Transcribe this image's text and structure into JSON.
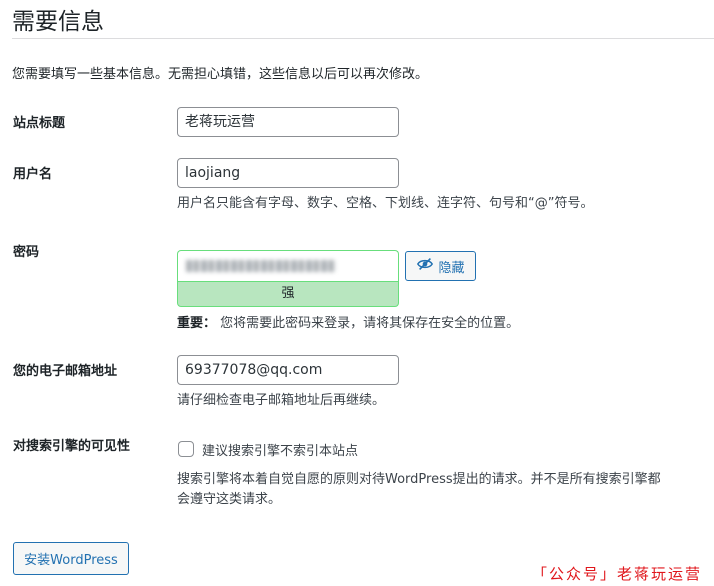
{
  "page": {
    "title": "需要信息",
    "intro": "您需要填写一些基本信息。无需担心填错，这些信息以后可以再次修改。"
  },
  "site_title": {
    "label": "站点标题",
    "value": "老蒋玩运营"
  },
  "username": {
    "label": "用户名",
    "value": "laojiang",
    "help": "用户名只能含有字母、数字、空格、下划线、连字符、句号和“@”符号。"
  },
  "password": {
    "label": "密码",
    "strength": "强",
    "hide_label": "隐藏",
    "note_bold": "重要：",
    "note": "您将需要此密码来登录，请将其保存在安全的位置。",
    "icon": "eye-slash-icon"
  },
  "email": {
    "label": "您的电子邮箱地址",
    "value": "69377078@qq.com",
    "help": "请仔细检查电子邮箱地址后再继续。"
  },
  "search_visibility": {
    "label": "对搜索引擎的可见性",
    "checkbox_label": "建议搜索引擎不索引本站点",
    "checked": false,
    "help_line1": "搜索引擎将本着自觉自愿的原则对待WordPress提出的请求。并不是所有搜索引擎都",
    "help_line2": "会遵守这类请求。"
  },
  "install_button": "安装WordPress",
  "watermark": "「公众号」老蒋玩运营",
  "colors": {
    "accent": "#2271b1",
    "strength_bg": "#b8e6bf",
    "strength_border": "#68de7c",
    "watermark": "#e0161b"
  }
}
